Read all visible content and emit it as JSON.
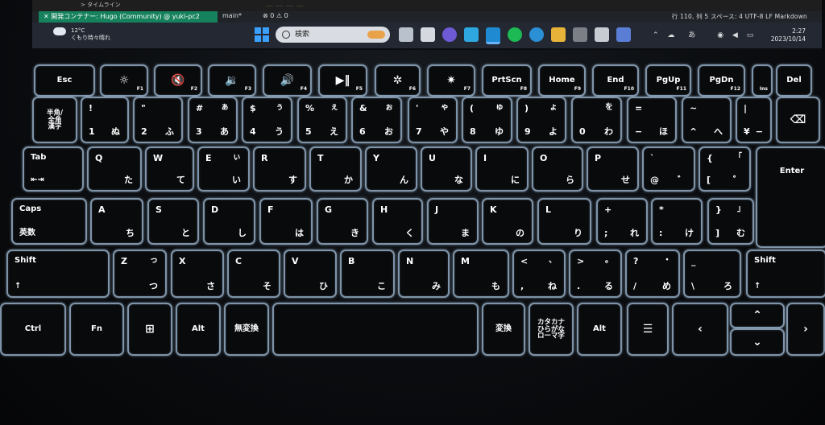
{
  "screen": {
    "outline_label": "> タイムライン",
    "code_fragment": "__ __ __ __",
    "remote_label": "✕ 開発コンテナー: Hugo (Community) @ yuki-pc2",
    "branch": "main*",
    "problems": "⊗ 0 ⚠ 0",
    "status_right": "行 110, 列 5   スペース: 4   UTF-8   LF   Markdown",
    "weather_temp": "12°C",
    "weather_desc": "くもり時々晴れ",
    "search_label": "検索",
    "tray": "あ",
    "clock_time": "2:27",
    "clock_date": "2023/10/14"
  },
  "keyboard": {
    "row_f": [
      {
        "name": "esc",
        "main": "Esc"
      },
      {
        "name": "f1",
        "icon": "brightness-down-icon",
        "glyph": "☼",
        "fn": "F1"
      },
      {
        "name": "f2",
        "icon": "mute-icon",
        "glyph": "🔇",
        "fn": "F2"
      },
      {
        "name": "f3",
        "icon": "volume-down-icon",
        "glyph": "🔉",
        "fn": "F3"
      },
      {
        "name": "f4",
        "icon": "volume-up-icon",
        "glyph": "🔊",
        "fn": "F4"
      },
      {
        "name": "f5",
        "icon": "play-pause-icon",
        "glyph": "▶‖",
        "fn": "F5"
      },
      {
        "name": "f6",
        "icon": "kbd-backlight-down-icon",
        "glyph": "✲",
        "fn": "F6"
      },
      {
        "name": "f7",
        "icon": "kbd-backlight-up-icon",
        "glyph": "✷",
        "fn": "F7"
      },
      {
        "name": "f8",
        "main": "PrtScn",
        "fn": "F8"
      },
      {
        "name": "f9",
        "main": "Home",
        "fn": "F9"
      },
      {
        "name": "f10",
        "main": "End",
        "fn": "F10"
      },
      {
        "name": "f11",
        "main": "PgUp",
        "fn": "F11"
      },
      {
        "name": "f12",
        "main": "PgDn",
        "fn": "F12"
      },
      {
        "name": "ins",
        "main": "",
        "fn": "Ins"
      },
      {
        "name": "del",
        "main": "Del"
      }
    ],
    "row_num": [
      {
        "name": "hankaku",
        "stack": [
          "半角/",
          "全角",
          "漢字"
        ]
      },
      {
        "name": "1",
        "tl": "!",
        "bl": "1",
        "br": "ぬ"
      },
      {
        "name": "2",
        "tl": "\"",
        "bl": "2",
        "br": "ふ"
      },
      {
        "name": "3",
        "tl": "#",
        "tr": "ぁ",
        "bl": "3",
        "br": "あ"
      },
      {
        "name": "4",
        "tl": "$",
        "tr": "ぅ",
        "bl": "4",
        "br": "う"
      },
      {
        "name": "5",
        "tl": "%",
        "tr": "ぇ",
        "bl": "5",
        "br": "え"
      },
      {
        "name": "6",
        "tl": "&",
        "tr": "ぉ",
        "bl": "6",
        "br": "お"
      },
      {
        "name": "7",
        "tl": "'",
        "tr": "ゃ",
        "bl": "7",
        "br": "や"
      },
      {
        "name": "8",
        "tl": "(",
        "tr": "ゅ",
        "bl": "8",
        "br": "ゆ"
      },
      {
        "name": "9",
        "tl": ")",
        "tr": "ょ",
        "bl": "9",
        "br": "よ"
      },
      {
        "name": "0",
        "tr": "を",
        "bl": "0",
        "br": "わ"
      },
      {
        "name": "minus",
        "tl": "=",
        "bl": "−",
        "br": "ほ"
      },
      {
        "name": "caret",
        "tl": "~",
        "bl": "^",
        "br": "へ"
      },
      {
        "name": "yen",
        "tl": "|",
        "bl": "¥",
        "br": "−"
      },
      {
        "name": "backspace",
        "icon": "backspace-icon",
        "glyph": "⌫"
      }
    ],
    "row_q": [
      {
        "name": "tab",
        "main": "Tab",
        "sub": "⇤⇥"
      },
      {
        "name": "q",
        "tl": "Q",
        "br": "た"
      },
      {
        "name": "w",
        "tl": "W",
        "br": "て"
      },
      {
        "name": "e",
        "tl": "E",
        "tr": "ぃ",
        "br": "い"
      },
      {
        "name": "r",
        "tl": "R",
        "br": "す"
      },
      {
        "name": "t",
        "tl": "T",
        "br": "か"
      },
      {
        "name": "y",
        "tl": "Y",
        "br": "ん"
      },
      {
        "name": "u",
        "tl": "U",
        "br": "な"
      },
      {
        "name": "i",
        "tl": "I",
        "br": "に"
      },
      {
        "name": "o",
        "tl": "O",
        "br": "ら"
      },
      {
        "name": "p",
        "tl": "P",
        "br": "せ"
      },
      {
        "name": "at",
        "tl": "`",
        "bl": "@",
        "br": "゛"
      },
      {
        "name": "bracket-open",
        "tl": "{",
        "tr": "「",
        "bl": "[",
        "br": "゜"
      }
    ],
    "enter_label": "Enter",
    "row_a": [
      {
        "name": "caps",
        "main": "Caps",
        "sub": "英数"
      },
      {
        "name": "a",
        "tl": "A",
        "br": "ち"
      },
      {
        "name": "s",
        "tl": "S",
        "br": "と"
      },
      {
        "name": "d",
        "tl": "D",
        "br": "し"
      },
      {
        "name": "f",
        "tl": "F",
        "br": "は"
      },
      {
        "name": "g",
        "tl": "G",
        "br": "き"
      },
      {
        "name": "h",
        "tl": "H",
        "br": "く"
      },
      {
        "name": "j",
        "tl": "J",
        "br": "ま"
      },
      {
        "name": "k",
        "tl": "K",
        "br": "の"
      },
      {
        "name": "l",
        "tl": "L",
        "br": "り"
      },
      {
        "name": "semicolon",
        "tl": "+",
        "bl": ";",
        "br": "れ"
      },
      {
        "name": "colon",
        "tl": "*",
        "bl": ":",
        "br": "け"
      },
      {
        "name": "bracket-close",
        "tl": "}",
        "tr": "」",
        "bl": "]",
        "br": "む"
      }
    ],
    "row_z": [
      {
        "name": "shift-left",
        "main": "Shift",
        "sub": "↑"
      },
      {
        "name": "z",
        "tl": "Z",
        "tr": "っ",
        "br": "つ"
      },
      {
        "name": "x",
        "tl": "X",
        "br": "さ"
      },
      {
        "name": "c",
        "tl": "C",
        "br": "そ"
      },
      {
        "name": "v",
        "tl": "V",
        "br": "ひ"
      },
      {
        "name": "b",
        "tl": "B",
        "br": "こ"
      },
      {
        "name": "n",
        "tl": "N",
        "br": "み"
      },
      {
        "name": "m",
        "tl": "M",
        "br": "も"
      },
      {
        "name": "comma",
        "tl": "<",
        "tr": "、",
        "bl": ",",
        "br": "ね"
      },
      {
        "name": "period",
        "tl": ">",
        "tr": "。",
        "bl": ".",
        "br": "る"
      },
      {
        "name": "slash",
        "tl": "?",
        "tr": "・",
        "bl": "/",
        "br": "め"
      },
      {
        "name": "backslash",
        "tl": "_",
        "bl": "\\",
        "br": "ろ"
      },
      {
        "name": "shift-right",
        "main": "Shift",
        "sub": "↑"
      }
    ],
    "row_bottom": [
      {
        "name": "ctrl",
        "main": "Ctrl"
      },
      {
        "name": "fn",
        "main": "Fn"
      },
      {
        "name": "windows",
        "icon": "windows-logo-icon",
        "glyph": "⊞"
      },
      {
        "name": "alt-left",
        "main": "Alt"
      },
      {
        "name": "muhenkan",
        "main": "無変換"
      },
      {
        "name": "space",
        "main": ""
      },
      {
        "name": "henkan",
        "main": "変換"
      },
      {
        "name": "kana",
        "stack": [
          "カタカナ",
          "ひらがな",
          "ローマ字"
        ]
      },
      {
        "name": "alt-right",
        "main": "Alt"
      },
      {
        "name": "menu",
        "icon": "context-menu-icon",
        "glyph": "☰"
      },
      {
        "name": "arrow-left",
        "icon": "arrow-left-icon",
        "glyph": "‹"
      },
      {
        "name": "arrow-up",
        "icon": "arrow-up-icon",
        "glyph": "⌃"
      },
      {
        "name": "arrow-down",
        "icon": "arrow-down-icon",
        "glyph": "⌄"
      },
      {
        "name": "arrow-right",
        "icon": "arrow-right-icon",
        "glyph": "›"
      }
    ]
  }
}
